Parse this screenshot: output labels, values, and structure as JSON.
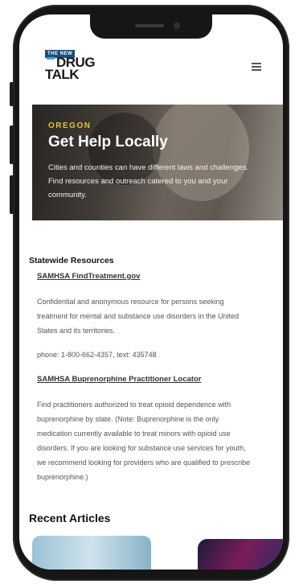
{
  "header": {
    "logo_top": "THE NEW",
    "logo_line1": "DRUG",
    "logo_line2": "TALK",
    "menu_icon": "hamburger-menu-icon"
  },
  "hero": {
    "eyebrow": "OREGON",
    "title": "Get Help Locally",
    "body": "Cities and counties can have different laws and challenges. Find resources and outreach catered to you and your community."
  },
  "resources": {
    "heading": "Statewide Resources",
    "items": [
      {
        "link": "SAMHSA FindTreatment.gov",
        "description": "Confidential and anonymous resource for persons seeking treatment for mental and substance use disorders in the United States and its territories.",
        "contact": "phone: 1-800-662-4357, text: 435748"
      },
      {
        "link": "SAMHSA Buprenorphine Practitioner Locator",
        "description": "Find practitioners authorized to treat opioid dependence with buprenorphine by state. (Note: Buprenorphine is the only medication currently available to treat minors with opioid use disorders. If you are looking for substance use services for youth, we recommend looking for providers who are qualified to prescribe buprenorphine.)"
      }
    ]
  },
  "recent": {
    "heading": "Recent Articles"
  },
  "colors": {
    "accent": "#e8c12e",
    "logo_blue": "#1a4f7a",
    "phone_frame": "#161616"
  }
}
